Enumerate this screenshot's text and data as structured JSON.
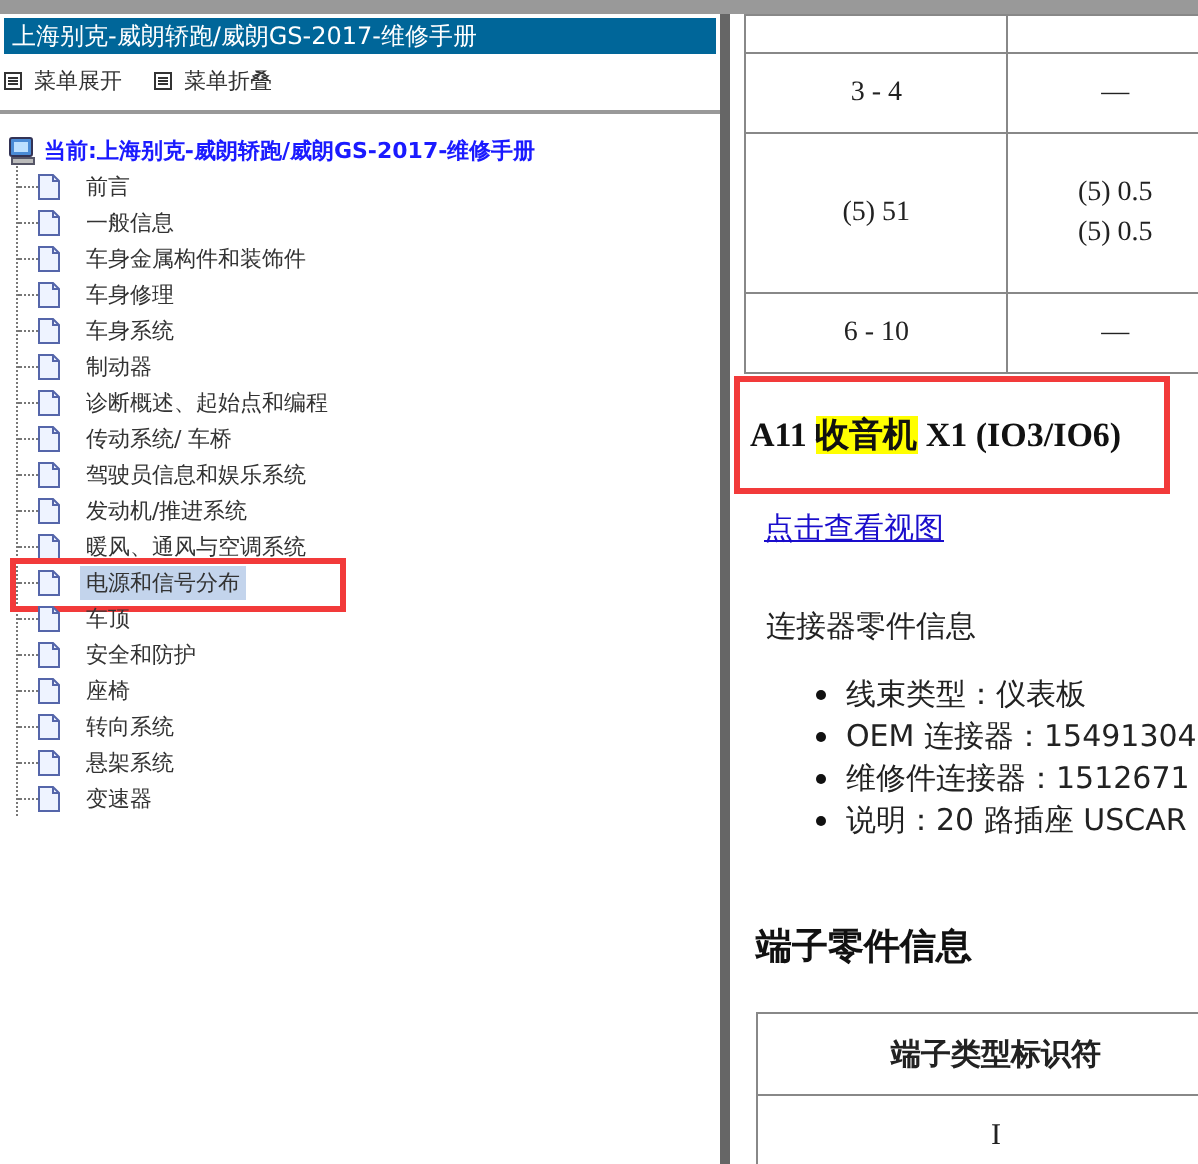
{
  "header": {
    "title": "上海别克-威朗轿跑/威朗GS-2017-维修手册"
  },
  "toolbar": [
    {
      "label": "菜单展开"
    },
    {
      "label": "菜单折叠"
    }
  ],
  "tree": {
    "label": "当前:上海别克-威朗轿跑/威朗GS-2017-维修手册",
    "children": [
      {
        "label": "前言",
        "selected": false,
        "annotated": false
      },
      {
        "label": "一般信息",
        "selected": false,
        "annotated": false
      },
      {
        "label": "车身金属构件和装饰件",
        "selected": false,
        "annotated": false
      },
      {
        "label": "车身修理",
        "selected": false,
        "annotated": false
      },
      {
        "label": "车身系统",
        "selected": false,
        "annotated": false
      },
      {
        "label": "制动器",
        "selected": false,
        "annotated": false
      },
      {
        "label": "诊断概述、起始点和编程",
        "selected": false,
        "annotated": false
      },
      {
        "label": "传动系统/ 车桥",
        "selected": false,
        "annotated": false
      },
      {
        "label": "驾驶员信息和娱乐系统",
        "selected": false,
        "annotated": false
      },
      {
        "label": "发动机/推进系统",
        "selected": false,
        "annotated": false
      },
      {
        "label": "暖风、通风与空调系统",
        "selected": false,
        "annotated": false
      },
      {
        "label": "电源和信号分布",
        "selected": true,
        "annotated": true
      },
      {
        "label": "车顶",
        "selected": false,
        "annotated": false
      },
      {
        "label": "安全和防护",
        "selected": false,
        "annotated": false
      },
      {
        "label": "座椅",
        "selected": false,
        "annotated": false
      },
      {
        "label": "转向系统",
        "selected": false,
        "annotated": false
      },
      {
        "label": "悬架系统",
        "selected": false,
        "annotated": false
      },
      {
        "label": "变速器",
        "selected": false,
        "annotated": false
      }
    ]
  },
  "content": {
    "spec_table": {
      "rows": [
        {
          "cells": [
            [],
            []
          ]
        },
        {
          "cells": [
            [
              "3 - 4"
            ],
            [
              "—"
            ]
          ]
        },
        {
          "cells": [
            [
              "(5) 51"
            ],
            [
              "(5) 0.5",
              "(5) 0.5"
            ]
          ]
        },
        {
          "cells": [
            [
              "6 - 10"
            ],
            [
              "—"
            ]
          ]
        }
      ]
    },
    "heading": {
      "annotated": true,
      "parts": [
        {
          "text": "A11 ",
          "highlighted": false
        },
        {
          "text": "收音机",
          "highlighted": true
        },
        {
          "text": " X1 (IO3/IO6)",
          "highlighted": false
        }
      ]
    },
    "link": "点击查看视图",
    "connector_title": "连接器零件信息",
    "connector_info": [
      "线束类型：仪表板",
      "OEM 连接器：15491304",
      "维修件连接器：1512671",
      "说明：20 路插座 USCAR"
    ],
    "terminal_title": "端子零件信息",
    "terminal_table": {
      "columns": [
        "端子类型标识符"
      ],
      "rows": [
        [
          "I"
        ]
      ]
    }
  }
}
